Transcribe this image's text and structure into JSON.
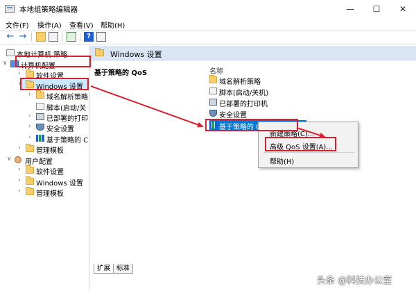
{
  "window": {
    "title": "本地组策略编辑器",
    "controls": {
      "minimize": "—",
      "maximize": "☐",
      "close": "✕"
    }
  },
  "menu": [
    "文件(F)",
    "操作(A)",
    "查看(V)",
    "帮助(H)"
  ],
  "toolbar": {
    "icons": [
      "back-arrow-icon",
      "forward-arrow-icon",
      "up-folder-icon",
      "show-hide-tree-icon",
      "export-list-icon",
      "help-icon",
      "properties-icon"
    ],
    "help_glyph": "?"
  },
  "tree": {
    "root": "本地计算机 策略",
    "computer_config": "计算机配置",
    "software_settings": "软件设置",
    "windows_settings": "Windows 设置",
    "dns_policy": "域名解析策略",
    "scripts": "脚本(启动/关",
    "deployed_printers": "已部署的打印",
    "security_settings": "安全设置",
    "qos_policy": "基于策略的 C",
    "admin_templates": "管理模板",
    "user_config": "用户配置",
    "user_software": "软件设置",
    "user_windows": "Windows 设置",
    "user_admin": "管理模板"
  },
  "right_pane": {
    "header": "Windows 设置",
    "description_title": "基于策略的 QoS",
    "column_name": "名称",
    "items": [
      "域名解析策略",
      "脚本(启动/关机)",
      "已部署的打印机",
      "安全设置",
      "基于策略的 QoS"
    ]
  },
  "context_menu": {
    "new_policy": "新建策略(C)...",
    "advanced_qos": "高级 QoS 设置(A)...",
    "help": "帮助(H)"
  },
  "tabs": [
    "扩展",
    "标准"
  ],
  "watermark": "头条 @科技办公室",
  "colors": {
    "annotation_red": "#d8202e",
    "selection_blue": "#0078d7",
    "tree_selection": "#cce8ff"
  }
}
